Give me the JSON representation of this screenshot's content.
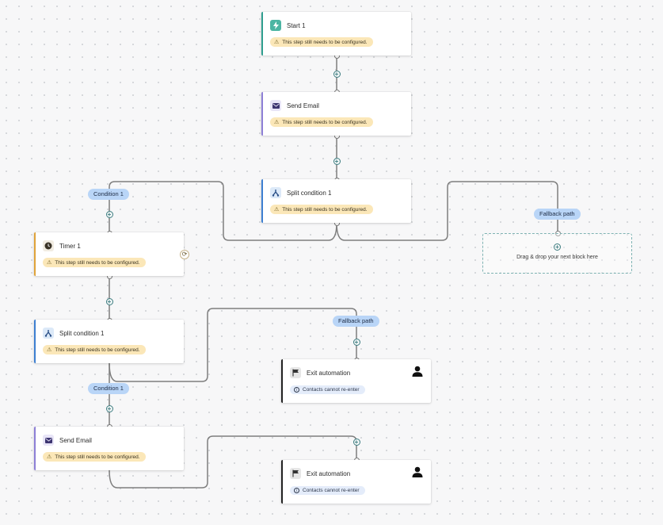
{
  "nodes": {
    "start": {
      "title": "Start 1",
      "warning": "This step still needs to be configured.",
      "accent": "#2f9e8f"
    },
    "send_email_1": {
      "title": "Send Email",
      "warning": "This step still needs to be configured.",
      "accent": "#8d7fd6"
    },
    "split_1": {
      "title": "Split condition 1",
      "warning": "This step still needs to be configured.",
      "accent": "#3d7fd1"
    },
    "timer_1": {
      "title": "Timer 1",
      "warning": "This step still needs to be configured.",
      "accent": "#e0a33a"
    },
    "split_2": {
      "title": "Split condition 1",
      "warning": "This step still needs to be configured.",
      "accent": "#3d7fd1"
    },
    "send_email_2": {
      "title": "Send Email",
      "warning": "This step still needs to be configured.",
      "accent": "#8d7fd6"
    },
    "exit_1": {
      "title": "Exit automation",
      "info": "Contacts cannot re-enter",
      "accent": "#222222"
    },
    "exit_2": {
      "title": "Exit automation",
      "info": "Contacts cannot re-enter",
      "accent": "#222222"
    }
  },
  "labels": {
    "condition_1_top": "Condition 1",
    "fallback_top": "Fallback path",
    "fallback_mid": "Fallback path",
    "condition_1_bottom": "Condition 1"
  },
  "dropzone": {
    "text": "Drag & drop your next block here"
  },
  "icons": {
    "start": "lightning-icon",
    "send_email": "envelope-icon",
    "split": "split-icon",
    "timer": "clock-icon",
    "exit": "flag-icon",
    "user": "user-icon",
    "refresh": "refresh-icon",
    "warning": "warning-icon",
    "info": "info-icon",
    "add": "plus-icon"
  }
}
